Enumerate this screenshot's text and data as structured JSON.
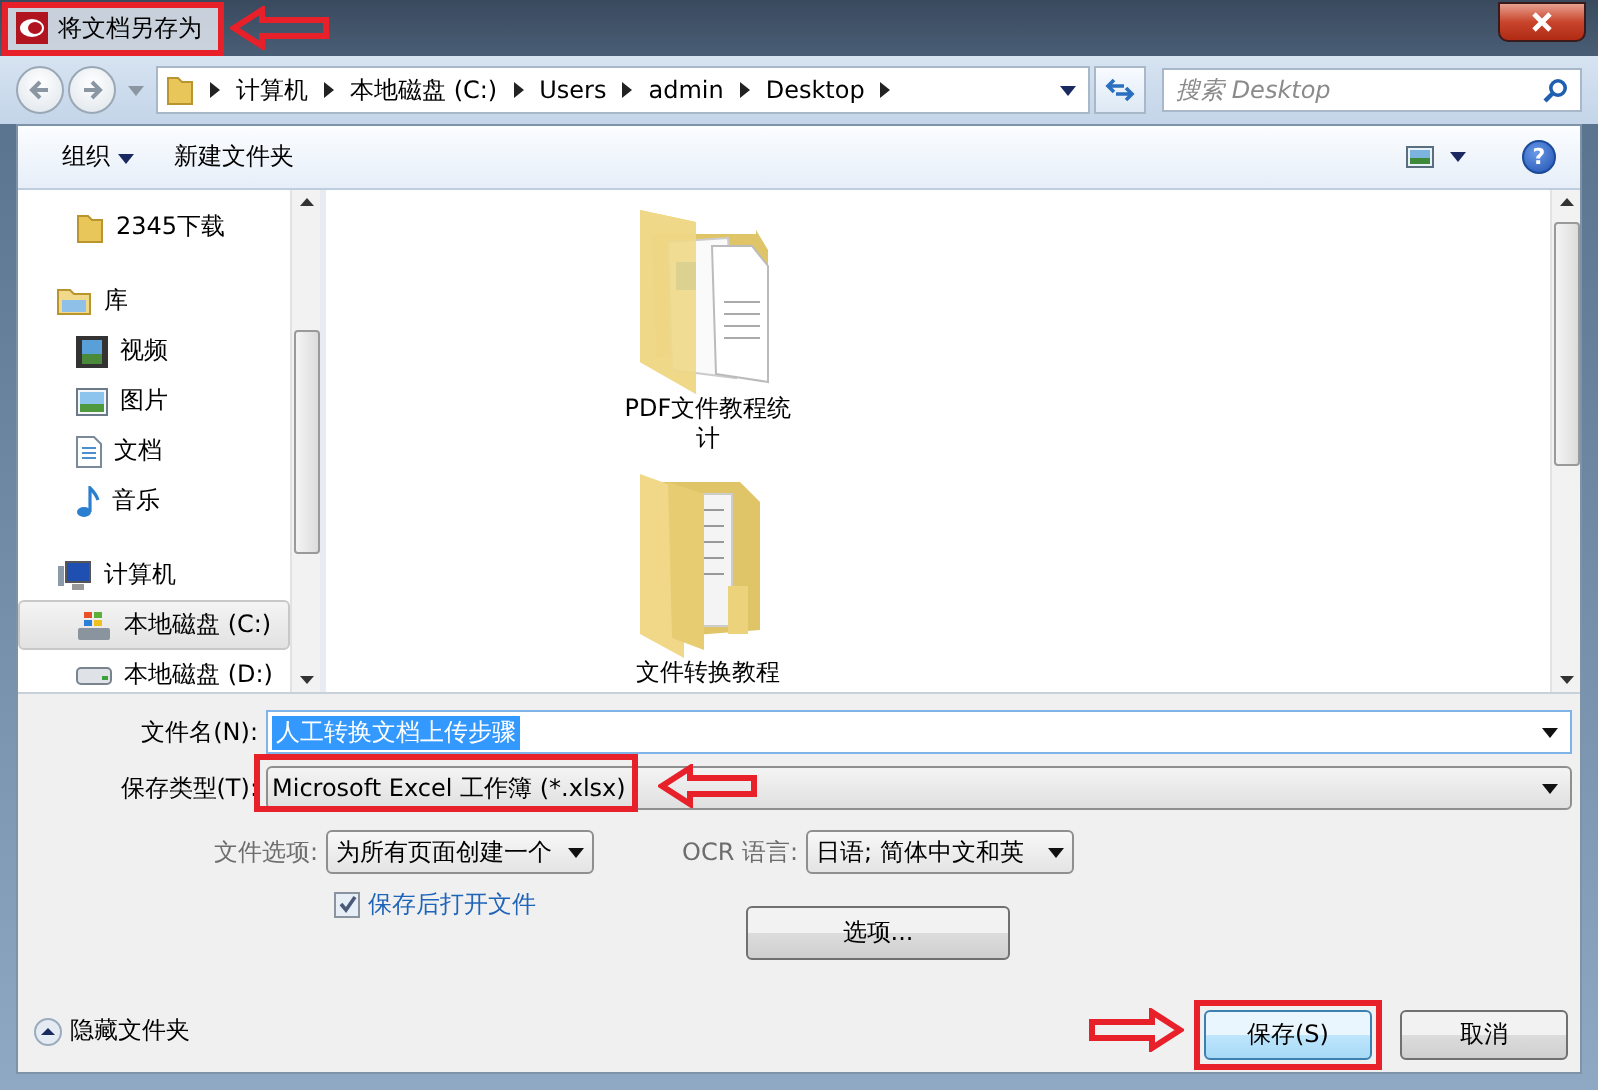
{
  "window": {
    "title": "将文档另存为",
    "highlighted": true
  },
  "address": {
    "breadcrumbs": [
      "计算机",
      "本地磁盘 (C:)",
      "Users",
      "admin",
      "Desktop"
    ],
    "search_placeholder": "搜索 Desktop"
  },
  "toolbar": {
    "organize": "组织",
    "new_folder": "新建文件夹",
    "help": "?"
  },
  "navigation": [
    {
      "label": "2345下载",
      "kind": "folder",
      "selected": false
    },
    {
      "label": "库",
      "kind": "library",
      "selected": false,
      "children": [
        {
          "label": "视频",
          "kind": "video",
          "selected": false
        },
        {
          "label": "图片",
          "kind": "picture",
          "selected": false
        },
        {
          "label": "文档",
          "kind": "document",
          "selected": false
        },
        {
          "label": "音乐",
          "kind": "music",
          "selected": false
        }
      ]
    },
    {
      "label": "计算机",
      "kind": "computer",
      "selected": false,
      "children": [
        {
          "label": "本地磁盘 (C:)",
          "kind": "system-drive",
          "selected": true
        },
        {
          "label": "本地磁盘 (D:)",
          "kind": "drive",
          "selected": false
        }
      ]
    }
  ],
  "files": [
    {
      "name": "PDF文件教程统计",
      "kind": "documents-folder"
    },
    {
      "name": "文件转换教程",
      "kind": "folder"
    }
  ],
  "form": {
    "file_name_label": "文件名(N):",
    "file_name": "人工转换文档上传步骤",
    "save_type_label": "保存类型(T):",
    "save_type": "Microsoft Excel 工作簿 (*.xlsx)",
    "save_type_highlighted": true,
    "file_options_label": "文件选项:",
    "file_options": "为所有页面创建一个",
    "ocr_label": "OCR 语言:",
    "ocr_language": "日语; 简体中文和英",
    "options_button": "选项...",
    "open_after_save": {
      "label": "保存后打开文件",
      "checked": true
    }
  },
  "hide_folders": "隐藏文件夹",
  "buttons": {
    "save": "保存(S)",
    "save_highlighted": true,
    "cancel": "取消"
  }
}
